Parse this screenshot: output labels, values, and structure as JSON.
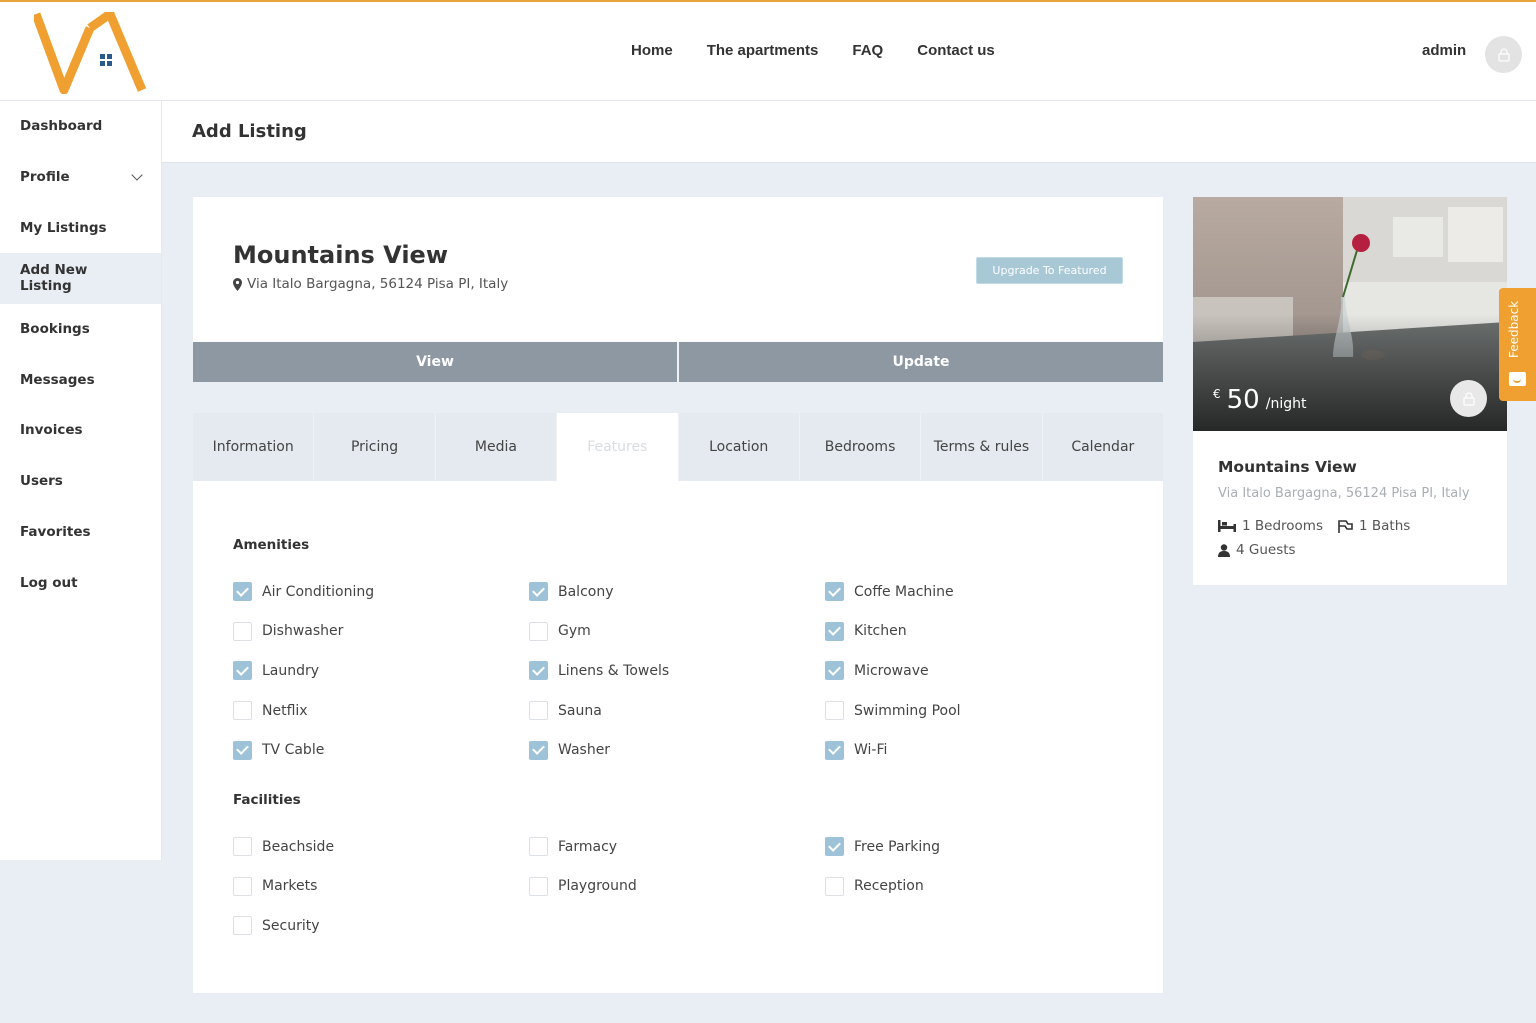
{
  "header": {
    "nav": [
      "Home",
      "The apartments",
      "FAQ",
      "Contact us"
    ],
    "user_name": "admin"
  },
  "sidebar": {
    "items": [
      {
        "label": "Dashboard"
      },
      {
        "label": "Profile"
      },
      {
        "label": "My Listings"
      },
      {
        "label": "Add New Listing"
      },
      {
        "label": "Bookings"
      },
      {
        "label": "Messages"
      },
      {
        "label": "Invoices"
      },
      {
        "label": "Users"
      },
      {
        "label": "Favorites"
      },
      {
        "label": "Log out"
      }
    ],
    "active_item": "Add New Listing"
  },
  "page": {
    "title": "Add Listing"
  },
  "listing": {
    "title": "Mountains View",
    "address": "Via Italo Bargagna, 56124 Pisa PI, Italy",
    "upgrade_label": "Upgrade To Featured",
    "view_label": "View",
    "update_label": "Update"
  },
  "tabs": [
    "Information",
    "Pricing",
    "Media",
    "Features",
    "Location",
    "Bedrooms",
    "Terms & rules",
    "Calendar"
  ],
  "active_tab": "Features",
  "amenities": {
    "title": "Amenities",
    "items": [
      {
        "label": "Air Conditioning",
        "checked": true
      },
      {
        "label": "Balcony",
        "checked": true
      },
      {
        "label": "Coffe Machine",
        "checked": true
      },
      {
        "label": "Dishwasher",
        "checked": false
      },
      {
        "label": "Gym",
        "checked": false
      },
      {
        "label": "Kitchen",
        "checked": true
      },
      {
        "label": "Laundry",
        "checked": true
      },
      {
        "label": "Linens & Towels",
        "checked": true
      },
      {
        "label": "Microwave",
        "checked": true
      },
      {
        "label": "Netflix",
        "checked": false
      },
      {
        "label": "Sauna",
        "checked": false
      },
      {
        "label": "Swimming Pool",
        "checked": false
      },
      {
        "label": "TV Cable",
        "checked": true
      },
      {
        "label": "Washer",
        "checked": true
      },
      {
        "label": "Wi-Fi",
        "checked": true
      }
    ]
  },
  "facilities": {
    "title": "Facilities",
    "items": [
      {
        "label": "Beachside",
        "checked": false
      },
      {
        "label": "Farmacy",
        "checked": false
      },
      {
        "label": "Free Parking",
        "checked": true
      },
      {
        "label": "Markets",
        "checked": false
      },
      {
        "label": "Playground",
        "checked": false
      },
      {
        "label": "Reception",
        "checked": false
      },
      {
        "label": "Security",
        "checked": false
      }
    ]
  },
  "preview": {
    "currency": "€",
    "price": "50",
    "price_unit": "/night",
    "title": "Mountains View",
    "address": "Via Italo Bargagna, 56124 Pisa PI, Italy",
    "bedrooms": "1 Bedrooms",
    "baths": "1 Baths",
    "guests": "4 Guests"
  },
  "feedback_label": "Feedback",
  "colors": {
    "accent": "#e8a33a",
    "checkbox_checked": "#9ec3d8",
    "action_bar": "#8d98a3",
    "page_bg": "#e8eef4"
  },
  "icons": [
    "logo",
    "avatar-icon",
    "chevron-down-icon",
    "map-marker-icon",
    "bed-icon",
    "bath-icon",
    "user-icon",
    "feedback-icon"
  ]
}
